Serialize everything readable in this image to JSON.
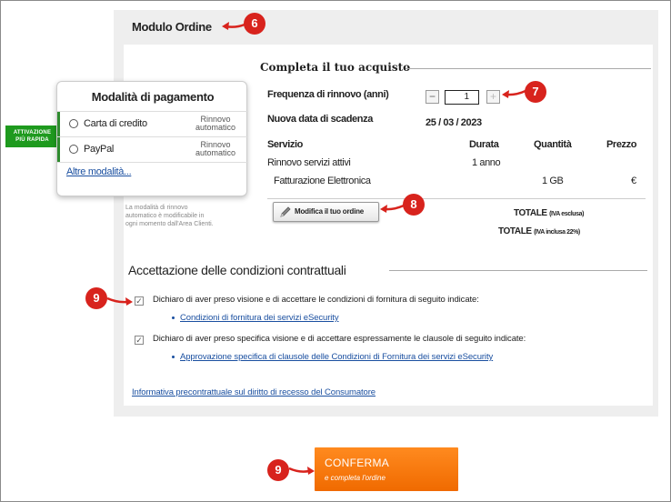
{
  "module": {
    "title": "Modulo Ordine"
  },
  "purchase": {
    "section_title": "Completa il tuo acquisto",
    "renewal_label": "Frequenza di rinnovo (anni)",
    "renewal_value": "1",
    "minus": "−",
    "plus": "+",
    "expiry_label": "Nuova data di scadenza",
    "expiry_value": "25 / 03 / 2023",
    "table": {
      "headers": {
        "service": "Servizio",
        "duration": "Durata",
        "quantity": "Quantità",
        "price": "Prezzo"
      },
      "rows": [
        {
          "service": "Rinnovo servizi attivi",
          "duration": "1 anno",
          "quantity": "",
          "price": ""
        },
        {
          "service": "Fatturazione Elettronica",
          "duration": "",
          "quantity": "1 GB",
          "price": "€"
        }
      ]
    },
    "modify_button": "Modifica il tuo ordine",
    "total_excl_label": "TOTALE",
    "total_excl_note": "(IVA esclusa)",
    "total_incl_label": "TOTALE",
    "total_incl_note": "(IVA inclusa 22%)"
  },
  "payment": {
    "title": "Modalità di pagamento",
    "options": [
      {
        "label": "Carta di credito",
        "auto": "Rinnovo automatico"
      },
      {
        "label": "PayPal",
        "auto": "Rinnovo automatico"
      }
    ],
    "auto_line1": "Rinnovo",
    "auto_line2": "automatico",
    "more_link": "Altre modalità...",
    "badge_line1": "ATTIVAZIONE",
    "badge_line2": "PIÙ RAPIDA",
    "note": "La modalità di rinnovo automatico è modificabile in ogni momento dall'Area Clienti."
  },
  "terms": {
    "section_title": "Accettazione delle condizioni contrattuali",
    "items": [
      {
        "checked": true,
        "text": "Dichiaro di aver preso visione e di accettare le condizioni di fornitura di seguito indicate:",
        "link": "Condizioni di fornitura dei servizi eSecurity"
      },
      {
        "checked": true,
        "text": "Dichiaro di aver preso specifica visione e di accettare espressamente le clausole di seguito indicate:",
        "link": "Approvazione specifica di clausole delle Condizioni di Fornitura dei servizi eSecurity"
      }
    ],
    "check_mark": "✓",
    "consumer_link": "Informativa precontrattuale sul diritto di recesso del Consumatore"
  },
  "confirm": {
    "label": "CONFERMA",
    "sub": "e completa l'ordine"
  },
  "markers": [
    "6",
    "7",
    "8",
    "9",
    "9"
  ],
  "colors": {
    "accent": "#f07a10",
    "marker": "#d8231d",
    "badge": "#1e9a1e",
    "link": "#1a4fa0"
  }
}
